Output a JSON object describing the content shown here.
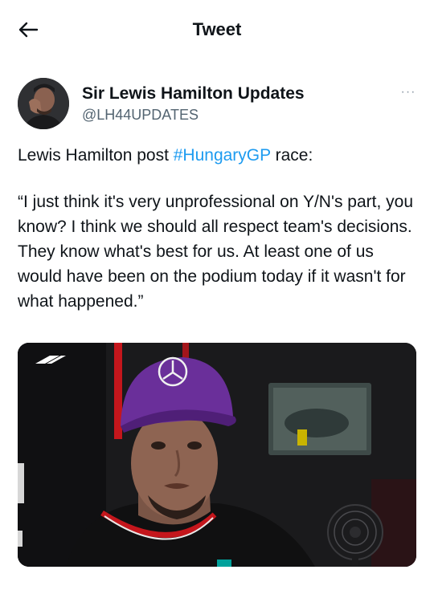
{
  "header": {
    "title": "Tweet"
  },
  "tweet": {
    "author": {
      "display_name": "Sir Lewis Hamilton Updates",
      "handle": "@LH44UPDATES"
    },
    "line1_prefix": "Lewis Hamilton post ",
    "hashtag": "#HungaryGP",
    "line1_suffix": " race:",
    "quote": "“I just think it's very unprofessional on Y/N's part, you know? I think we should all respect team's decisions. They know what's best for us. At least one of us would have been on the podium today if it wasn't for what happened.”",
    "media": {
      "watermark": "F1"
    }
  },
  "colors": {
    "link": "#1d9bf0",
    "text": "#0f1419",
    "secondary": "#536471",
    "cap_purple": "#6a2f9a"
  },
  "icons": {
    "back": "arrow-left-icon",
    "more": "more-horizontal-icon"
  }
}
